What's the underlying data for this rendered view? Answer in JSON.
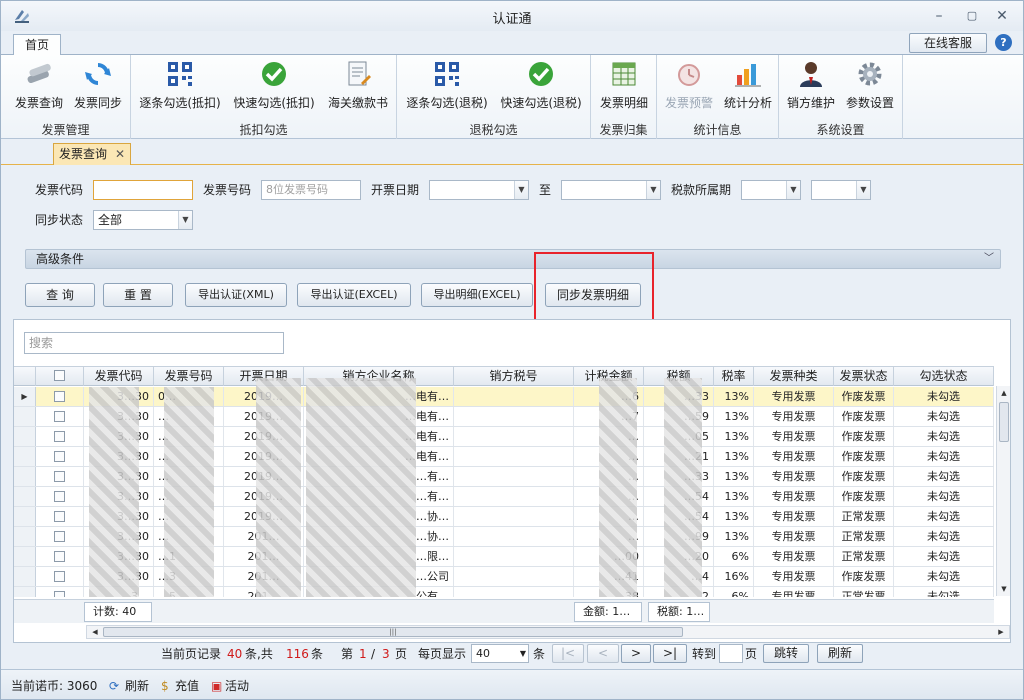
{
  "window": {
    "title": "认证通"
  },
  "tabs": {
    "home": "首页",
    "service": "在线客服",
    "help": "?"
  },
  "ribbon": {
    "groups": [
      {
        "title": "发票管理",
        "buttons": [
          "发票查询",
          "发票同步"
        ]
      },
      {
        "title": "抵扣勾选",
        "buttons": [
          "逐条勾选(抵扣)",
          "快速勾选(抵扣)",
          "海关缴款书"
        ]
      },
      {
        "title": "退税勾选",
        "buttons": [
          "逐条勾选(退税)",
          "快速勾选(退税)"
        ]
      },
      {
        "title": "发票归集",
        "buttons": [
          "发票明细"
        ]
      },
      {
        "title": "统计信息",
        "buttons": [
          "发票预警",
          "统计分析"
        ]
      },
      {
        "title": "系统设置",
        "buttons": [
          "销方维护",
          "参数设置"
        ]
      }
    ]
  },
  "doc_tab": {
    "label": "发票查询",
    "close": "✕"
  },
  "form": {
    "invoice_code_label": "发票代码",
    "invoice_code_value": "",
    "invoice_no_label": "发票号码",
    "invoice_no_placeholder": "8位发票号码",
    "issue_date_label": "开票日期",
    "to_label": "至",
    "tax_period_label": "税款所属期",
    "sync_status_label": "同步状态",
    "sync_status_value": "全部",
    "advanced": "高级条件"
  },
  "actions": {
    "query": "查  询",
    "reset": "重  置",
    "export_xml": "导出认证(XML)",
    "export_excel": "导出认证(EXCEL)",
    "export_detail": "导出明细(EXCEL)",
    "sync_detail": "同步发票明细"
  },
  "grid": {
    "search_placeholder": "搜索",
    "columns": [
      "发票代码",
      "发票号码",
      "开票日期",
      "销方企业名称",
      "销方税号",
      "计税金额",
      "税额",
      "税率",
      "发票种类",
      "发票状态",
      "勾选状态"
    ],
    "rows": [
      {
        "code": "3…30",
        "no": "0…",
        "date": "2019…",
        "seller": "…电有…",
        "amount": "…6",
        "tax": "…33",
        "rate": "13%",
        "kind": "专用发票",
        "status": "作废发票",
        "check": "未勾选"
      },
      {
        "code": "3…30",
        "no": "…",
        "date": "2019…",
        "seller": "…电有…",
        "amount": "…7",
        "tax": "…59",
        "rate": "13%",
        "kind": "专用发票",
        "status": "作废发票",
        "check": "未勾选"
      },
      {
        "code": "3…30",
        "no": "…",
        "date": "2019…",
        "seller": "…电有…",
        "amount": "…",
        "tax": "…05",
        "rate": "13%",
        "kind": "专用发票",
        "status": "作废发票",
        "check": "未勾选"
      },
      {
        "code": "3…30",
        "no": "…",
        "date": "2019…",
        "seller": "…电有…",
        "amount": "…",
        "tax": "…21",
        "rate": "13%",
        "kind": "专用发票",
        "status": "作废发票",
        "check": "未勾选"
      },
      {
        "code": "3…30",
        "no": "…",
        "date": "2019…",
        "seller": "…有…",
        "amount": "…",
        "tax": "…33",
        "rate": "13%",
        "kind": "专用发票",
        "status": "作废发票",
        "check": "未勾选"
      },
      {
        "code": "3…30",
        "no": "…",
        "date": "2019…",
        "seller": "…有…",
        "amount": "…",
        "tax": "…54",
        "rate": "13%",
        "kind": "专用发票",
        "status": "作废发票",
        "check": "未勾选"
      },
      {
        "code": "3…30",
        "no": "…",
        "date": "2019…",
        "seller": "…协…",
        "amount": "…",
        "tax": "…54",
        "rate": "13%",
        "kind": "专用发票",
        "status": "正常发票",
        "check": "未勾选"
      },
      {
        "code": "3…30",
        "no": "…",
        "date": "201…",
        "seller": "…协…",
        "amount": "…",
        "tax": "…99",
        "rate": "13%",
        "kind": "专用发票",
        "status": "正常发票",
        "check": "未勾选"
      },
      {
        "code": "3…30",
        "no": "…1",
        "date": "201…",
        "seller": "…限…",
        "amount": "…00",
        "tax": "…20",
        "rate": "6%",
        "kind": "专用发票",
        "status": "正常发票",
        "check": "未勾选"
      },
      {
        "code": "3…30",
        "no": "…3",
        "date": "201…",
        "seller": "…公司",
        "amount": "…41",
        "tax": "…4",
        "rate": "16%",
        "kind": "专用发票",
        "status": "作废发票",
        "check": "未勾选"
      },
      {
        "code": "3…",
        "no": "…5",
        "date": "201…",
        "seller": "…公有…",
        "amount": "…38",
        "tax": "…2",
        "rate": "6%",
        "kind": "专用发票",
        "status": "正常发票",
        "check": "未勾选"
      }
    ],
    "count_label": "计数: 40",
    "sum_amount": "金额: 1…",
    "sum_tax": "税额: 1…"
  },
  "pager": {
    "current_prefix": "当前页记录",
    "current_count": "40",
    "mid": "条,共",
    "total": "116",
    "suffix": "条",
    "page_prefix": "第",
    "page": "1",
    "slash": "/",
    "pages": "3",
    "page_suffix": "页",
    "per_page_label": "每页显示",
    "per_page": "40",
    "per_page_suffix": "条",
    "first": "|<",
    "prev": "<",
    "next": ">",
    "last": ">|",
    "goto_label": "转到",
    "goto_suffix": "页",
    "jump": "跳转",
    "refresh": "刷新"
  },
  "status": {
    "coins": "当前诺币: 3060",
    "refresh": "刷新",
    "recharge": "充值",
    "activity": "活动"
  },
  "colors": {
    "accent": "#2f6fc0",
    "highlight": "#e8232b",
    "selected_row": "#fdf6c8"
  }
}
